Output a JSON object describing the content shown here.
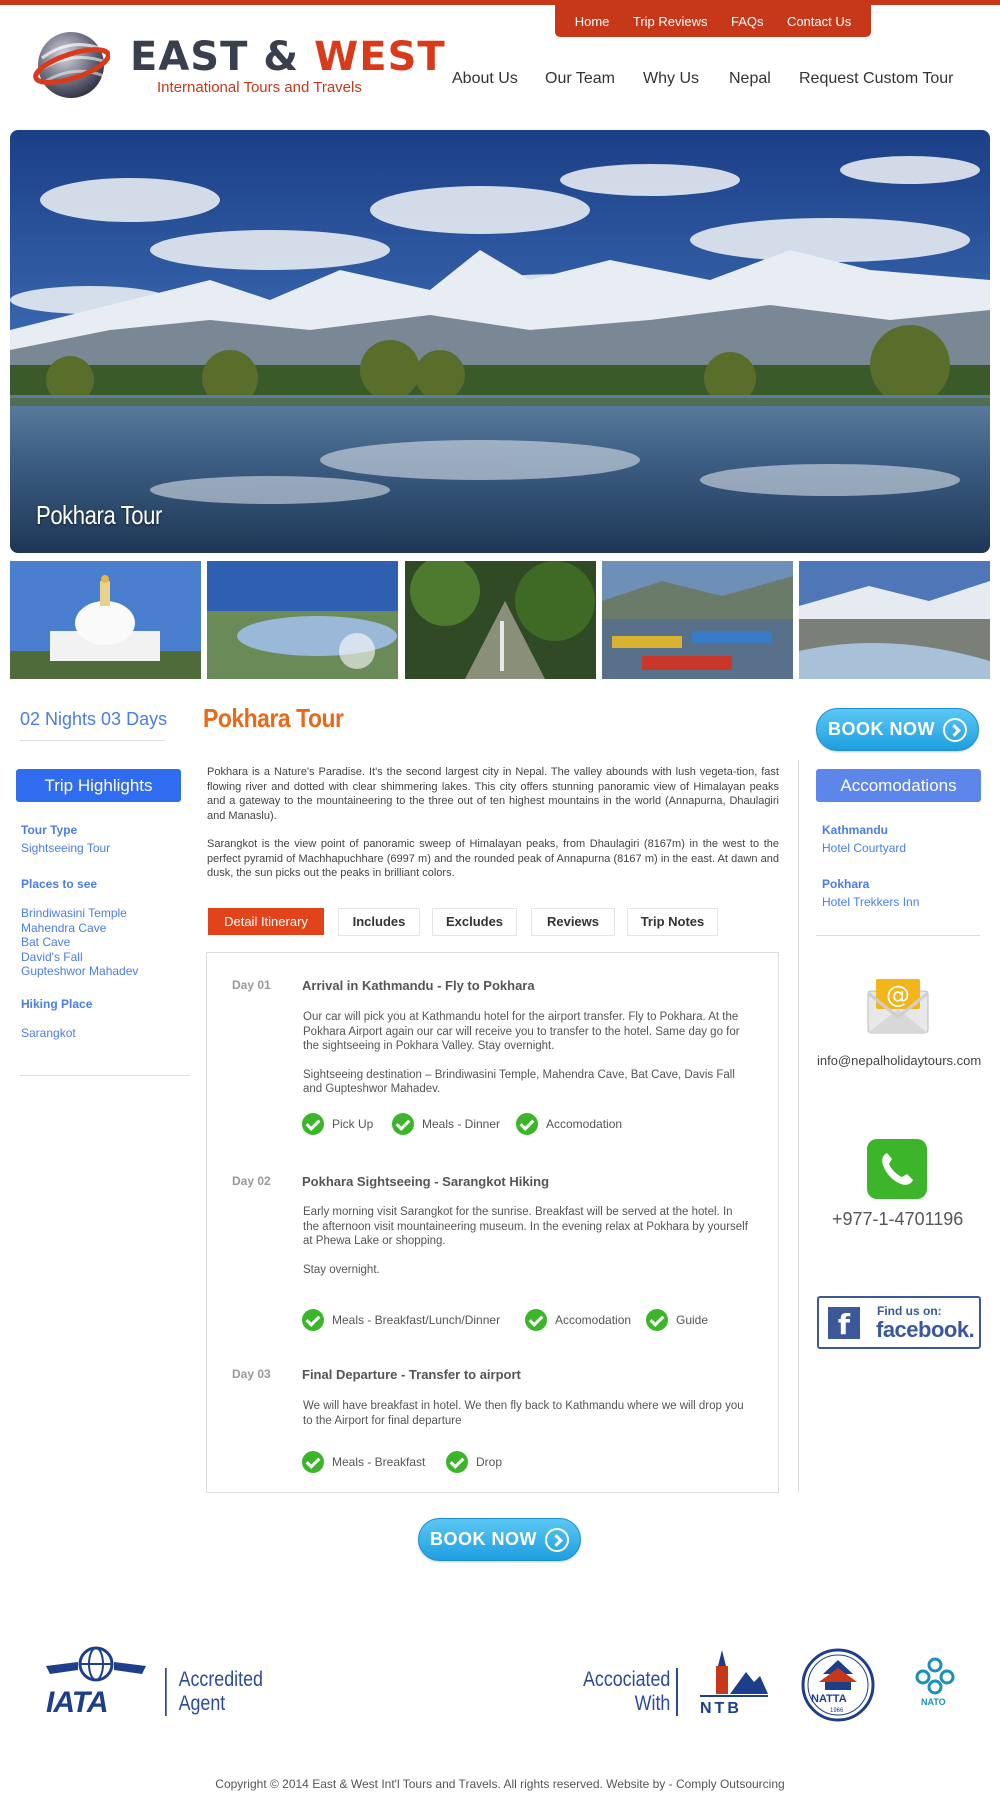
{
  "brand": {
    "name_part1": "EAST &",
    "name_part2": "WEST",
    "tagline": "International Tours and Travels"
  },
  "top_nav": [
    "Home",
    "Trip Reviews",
    "FAQs",
    "Contact Us"
  ],
  "main_nav": [
    "About Us",
    "Our Team",
    "Why Us",
    "Nepal",
    "Request Custom Tour"
  ],
  "hero": {
    "caption": "Pokhara Tour"
  },
  "left": {
    "duration": "02 Nights 03 Days",
    "highlights_button": "Trip Highlights",
    "tour_type_heading": "Tour Type",
    "tour_type": "Sightseeing Tour",
    "places_heading": "Places to see",
    "places": [
      "Brindiwasini Temple",
      "Mahendra Cave",
      "Bat Cave",
      "David's Fall",
      "Gupteshwor Mahadev"
    ],
    "hiking_heading": "Hiking Place",
    "hiking": "Sarangkot"
  },
  "main": {
    "title": "Pokhara Tour",
    "intro_p1": "Pokhara is a Nature's Paradise. It's the second largest city in Nepal. The valley abounds with lush vegeta-tion, fast flowing river and dotted with clear shimmering lakes. This city offers stunning panoramic view of Himalayan peaks and a gateway to the mountaineering to the three out of ten highest mountains in the world (Annapurna, Dhaulagiri and Manaslu).",
    "intro_p2": "Sarangkot is the view point of panoramic sweep of Himalayan peaks, from Dhaulagiri (8167m) in the west to the perfect pyramid of Machhapuchhare (6997 m) and the rounded peak of Annapurna (8167 m) in the east. At dawn and dusk, the sun picks out the peaks in brilliant colors.",
    "tabs": [
      "Detail Itinerary",
      "Includes",
      "Excludes",
      "Reviews",
      "Trip Notes"
    ],
    "days": [
      {
        "label": "Day 01",
        "title": "Arrival in Kathmandu - Fly to Pokhara",
        "p1": "Our car will pick you at Kathmandu hotel for the airport transfer. Fly to Pokhara. At the Pokhara Airport again our       car will receive you to transfer to the hotel. Same day go for the sightseeing in Pokhara Valley. Stay overnight.",
        "p2": "Sightseeing destination – Brindiwasini Temple, Mahendra Cave, Bat Cave, Davis Fall and Gupteshwor Mahadev.",
        "features": [
          "Pick Up",
          "Meals - Dinner",
          "Accomodation"
        ]
      },
      {
        "label": "Day 02",
        "title": "Pokhara Sightseeing - Sarangkot Hiking",
        "p1": "Early morning visit Sarangkot for the sunrise. Breakfast will be served at the hotel. In the afternoon visit mountaineering museum. In the evening relax at Pokhara by yourself at Phewa Lake or shopping.",
        "p2": "Stay overnight.",
        "features": [
          "Meals - Breakfast/Lunch/Dinner",
          "Accomodation",
          "Guide"
        ]
      },
      {
        "label": "Day 03",
        "title": "Final Departure - Transfer to airport",
        "p1": "We will have breakfast in hotel. We then fly back to Kathmandu where we will drop you to the Airport for final departure",
        "features": [
          "Meals - Breakfast",
          "Drop"
        ]
      }
    ],
    "book_now": "BOOK NOW"
  },
  "right": {
    "book_now": "BOOK NOW",
    "accommodations_button": "Accomodations",
    "stays": [
      {
        "city": "Kathmandu",
        "hotel": "Hotel Courtyard"
      },
      {
        "city": "Pokhara",
        "hotel": "Hotel Trekkers Inn"
      }
    ],
    "email": "info@nepalholidaytours.com",
    "phone": "+977-1-4701196",
    "facebook_find": "Find us on:",
    "facebook_name": "facebook."
  },
  "footer": {
    "iata_text": "IATA",
    "accredited": [
      "Accredited",
      "Agent"
    ],
    "associated": [
      "Accociated",
      "With"
    ],
    "ntb_text": "NTB",
    "natta_text": "NATTA",
    "natta_year": "1966",
    "nato_text": "NATO",
    "copyright": "Copyright © 2014 East & West Int'l Tours and Travels. All rights reserved. Website by - Comply Outsourcing"
  },
  "colors": {
    "accent": "#c7381a",
    "title_orange": "#e86a17",
    "link_blue": "#4a7de8",
    "button_blue": "#2f6cf0",
    "check_green": "#3cb52a",
    "facebook_blue": "#3b5998"
  }
}
